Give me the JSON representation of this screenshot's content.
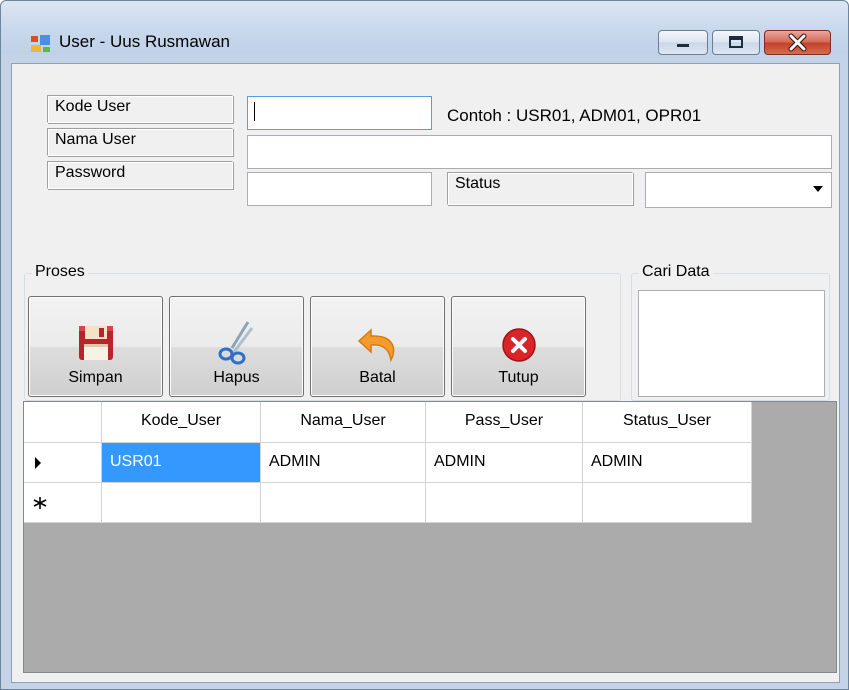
{
  "window": {
    "title": "User - Uus Rusmawan",
    "controls": [
      "minimize",
      "maximize",
      "close"
    ]
  },
  "form": {
    "kode_label": "Kode User",
    "nama_label": "Nama User",
    "password_label": "Password",
    "status_label": "Status",
    "kode_value": "",
    "nama_value": "",
    "password_value": "",
    "status_value": "",
    "hint": "Contoh : USR01, ADM01, OPR01"
  },
  "proses": {
    "legend": "Proses",
    "buttons": [
      {
        "label": "Simpan",
        "icon": "floppy-disk-icon"
      },
      {
        "label": "Hapus",
        "icon": "scissors-icon"
      },
      {
        "label": "Batal",
        "icon": "undo-arrow-icon"
      },
      {
        "label": "Tutup",
        "icon": "close-circle-icon"
      }
    ]
  },
  "cari": {
    "legend": "Cari Data"
  },
  "grid": {
    "columns": [
      "Kode_User",
      "Nama_User",
      "Pass_User",
      "Status_User"
    ],
    "rows": [
      [
        "USR01",
        "ADMIN",
        "ADMIN",
        "ADMIN"
      ]
    ],
    "current_row_marker": "▸",
    "new_row_marker": "✳"
  },
  "colors": {
    "selection": "#3399ff",
    "grid_background": "#ababab",
    "title_bar": "#c8d8ec"
  }
}
